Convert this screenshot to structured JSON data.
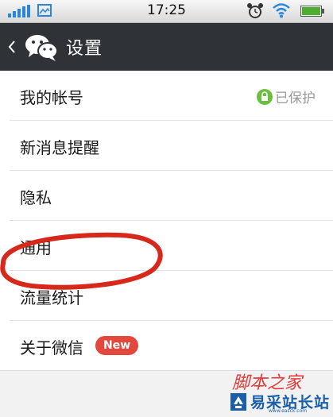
{
  "status_bar": {
    "time": "17:25",
    "icons": [
      "signal-icon",
      "picture-icon",
      "alarm-icon",
      "wifi-icon",
      "battery-icon"
    ],
    "signal_color": "#2a86d8",
    "battery_color": "#4caf2f"
  },
  "header": {
    "title": "设置",
    "icons": [
      "back-arrow-icon",
      "wechat-logo-icon"
    ],
    "background": "#2f3236"
  },
  "settings": {
    "items": [
      {
        "label": "我的帐号",
        "status": "已保护"
      },
      {
        "label": "新消息提醒"
      },
      {
        "label": "隐私"
      },
      {
        "label": "通用"
      },
      {
        "label": "流量统计"
      },
      {
        "label": "关于微信",
        "badge": "New"
      }
    ]
  },
  "colors": {
    "protect_icon": "#6bbf3f",
    "new_badge": "#e4473b",
    "annotation": "#d7281c"
  },
  "watermark": {
    "line1": "脚本之家",
    "brand": "易采站长站",
    "sub": "www.easck.com"
  }
}
